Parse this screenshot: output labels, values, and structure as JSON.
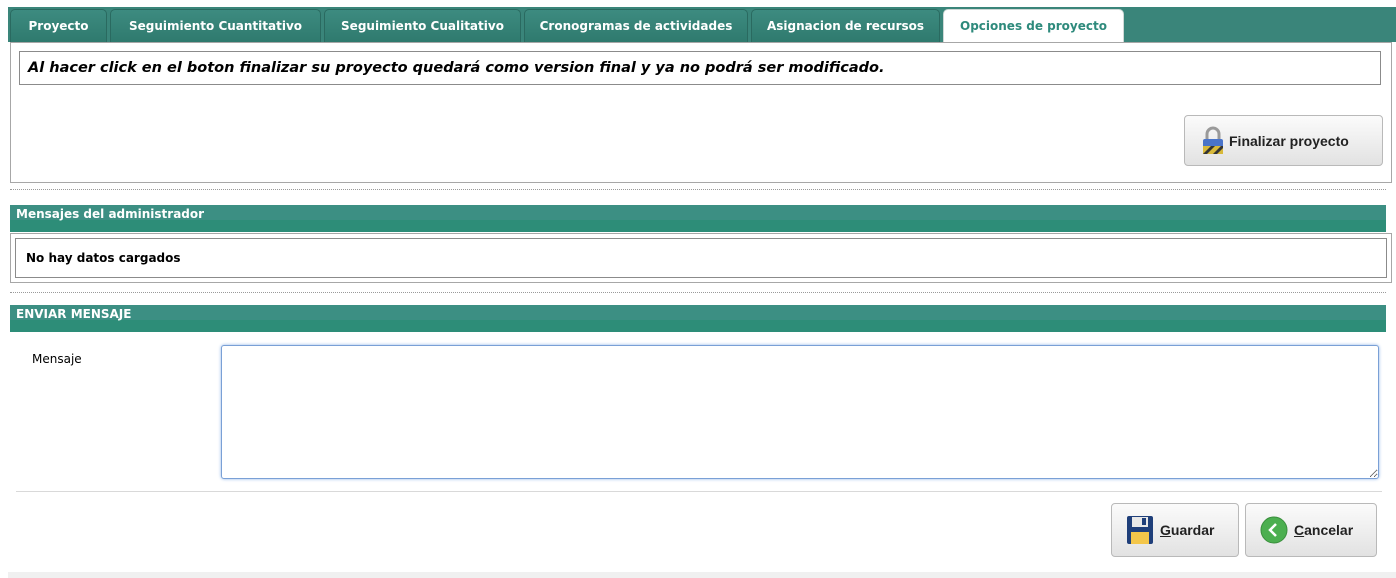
{
  "tabs": [
    {
      "label": "Proyecto",
      "active": false
    },
    {
      "label": "Seguimiento Cuantitativo",
      "active": false
    },
    {
      "label": "Seguimiento Cualitativo",
      "active": false
    },
    {
      "label": "Cronogramas de actividades",
      "active": false
    },
    {
      "label": "Asignacion de recursos",
      "active": false
    },
    {
      "label": "Opciones de proyecto",
      "active": true
    }
  ],
  "notice": {
    "text": "Al hacer click en el boton finalizar su proyecto quedará como version final y ya no podrá ser modificado."
  },
  "finalize_button": {
    "label": "Finalizar proyecto",
    "icon": "lock-icon"
  },
  "admin_messages": {
    "title": "Mensajes del administrador",
    "empty_text": "No hay datos cargados"
  },
  "send_message": {
    "title": "ENVIAR MENSAJE",
    "field_label": "Mensaje",
    "field_value": ""
  },
  "actions": {
    "save": {
      "underlined": "G",
      "rest": "uardar",
      "icon": "floppy-disk-icon"
    },
    "cancel": {
      "underlined": "C",
      "rest": "ancelar",
      "icon": "back-arrow-icon"
    }
  },
  "colors": {
    "header_teal": "#3c8f83",
    "active_tab_text": "#2e8a7c",
    "cancel_icon_green": "#4caf50"
  }
}
